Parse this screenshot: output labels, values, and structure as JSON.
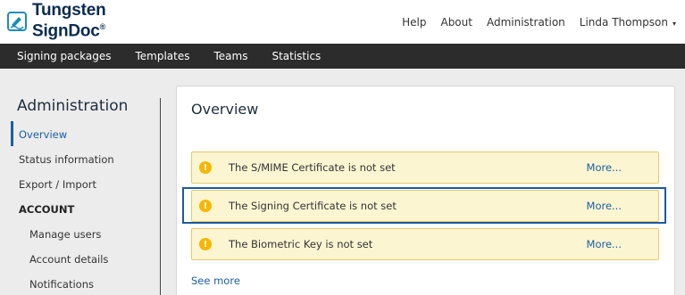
{
  "brand": {
    "line1": "Tungsten",
    "line2": "SignDoc",
    "reg": "®"
  },
  "topnav": {
    "help": "Help",
    "about": "About",
    "administration": "Administration",
    "user": "Linda Thompson",
    "caret": "▾"
  },
  "mainnav": {
    "items": [
      "Signing packages",
      "Templates",
      "Teams",
      "Statistics"
    ]
  },
  "sidebar": {
    "title": "Administration",
    "items": {
      "overview": "Overview",
      "status": "Status information",
      "export": "Export / Import",
      "account_section": "ACCOUNT",
      "manage_users": "Manage users",
      "account_details": "Account details",
      "notifications": "Notifications"
    }
  },
  "panel": {
    "title": "Overview",
    "alerts": [
      {
        "icon": "warning-icon",
        "message": "The S/MIME Certificate is not set",
        "more": "More..."
      },
      {
        "icon": "warning-icon",
        "message": "The Signing Certificate is not set",
        "more": "More..."
      },
      {
        "icon": "warning-icon",
        "message": "The Biometric Key is not set",
        "more": "More..."
      }
    ],
    "see_more": "See more",
    "warning_glyph": "!"
  },
  "colors": {
    "accent": "#1a5fa4",
    "navbar": "#2c2c2c",
    "alert_bg": "#fcf5d2",
    "alert_border": "#e8c96b",
    "warning": "#f5b700",
    "highlight": "#1c5a9c"
  }
}
